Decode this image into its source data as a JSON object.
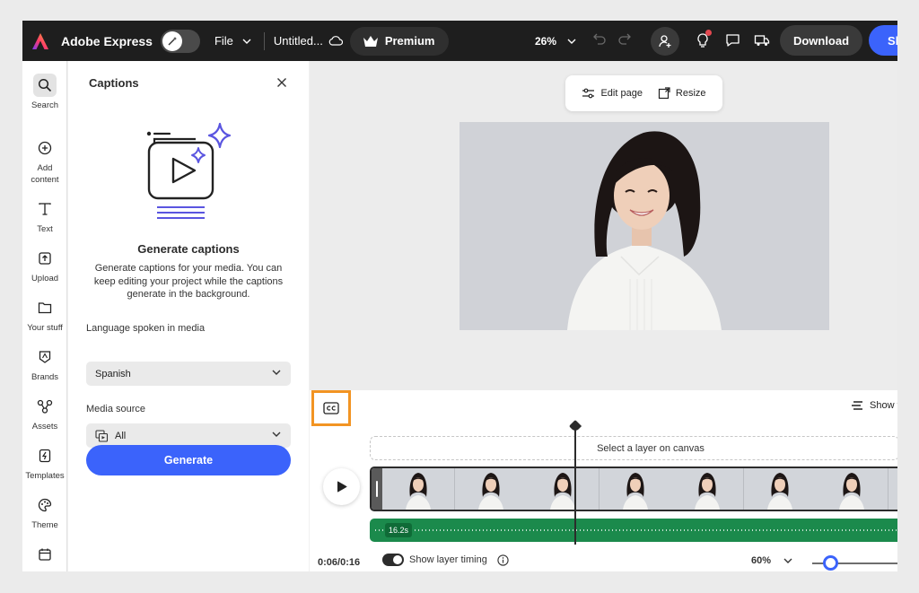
{
  "app": {
    "name": "Adobe Express",
    "brand_color": "#3b63fb"
  },
  "topbar": {
    "file_label": "File",
    "doc_title": "Untitled...",
    "premium_label": "Premium",
    "zoom_level": "26%",
    "download_label": "Download",
    "share_label": "Sh"
  },
  "rail": {
    "items": [
      {
        "label": "Search",
        "icon": "search-icon"
      },
      {
        "label": "Add content",
        "icon": "plus-circle-icon"
      },
      {
        "label": "Text",
        "icon": "text-icon"
      },
      {
        "label": "Upload",
        "icon": "upload-icon"
      },
      {
        "label": "Your stuff",
        "icon": "folder-icon"
      },
      {
        "label": "Brands",
        "icon": "brand-icon"
      },
      {
        "label": "Assets",
        "icon": "assets-icon"
      },
      {
        "label": "Templates",
        "icon": "templates-icon"
      },
      {
        "label": "Theme",
        "icon": "palette-icon"
      }
    ]
  },
  "panel": {
    "title": "Captions",
    "heading": "Generate captions",
    "description": "Generate captions for your media. You can keep editing your project while the captions generate in the background.",
    "language_label": "Language spoken in media",
    "language_value": "Spanish",
    "source_label": "Media source",
    "source_value": "All",
    "generate_label": "Generate"
  },
  "canvas": {
    "edit_page_label": "Edit page",
    "resize_label": "Resize"
  },
  "timeline": {
    "show_timing_top": "Show t",
    "caption_placeholder": "Select a layer on canvas",
    "audio_duration": "16.2s",
    "time_readout": "0:06/0:16",
    "show_layer_timing": "Show layer timing",
    "zoom_level": "60%"
  }
}
